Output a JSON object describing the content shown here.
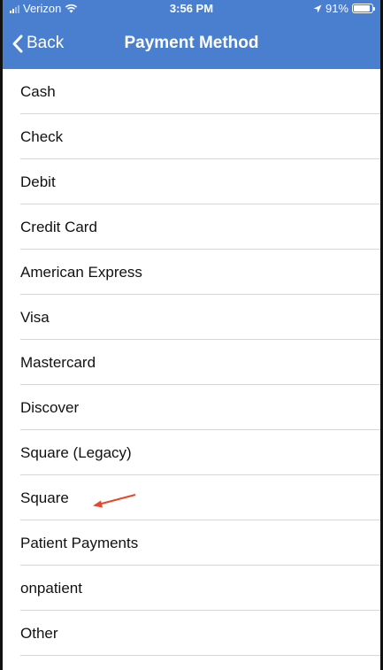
{
  "status_bar": {
    "carrier": "Verizon",
    "time": "3:56 PM",
    "battery": "91%",
    "battery_level": 0.91
  },
  "nav": {
    "back_label": "Back",
    "title": "Payment Method",
    "back_icon": "chevron-left-icon"
  },
  "payment_methods": [
    {
      "label": "Cash"
    },
    {
      "label": "Check"
    },
    {
      "label": "Debit"
    },
    {
      "label": "Credit Card"
    },
    {
      "label": "American Express"
    },
    {
      "label": "Visa"
    },
    {
      "label": "Mastercard"
    },
    {
      "label": "Discover"
    },
    {
      "label": "Square (Legacy)"
    },
    {
      "label": "Square"
    },
    {
      "label": "Patient Payments"
    },
    {
      "label": "onpatient"
    },
    {
      "label": "Other"
    }
  ],
  "colors": {
    "nav_background": "#4a7fd0",
    "annotation_arrow": "#e8452c"
  }
}
